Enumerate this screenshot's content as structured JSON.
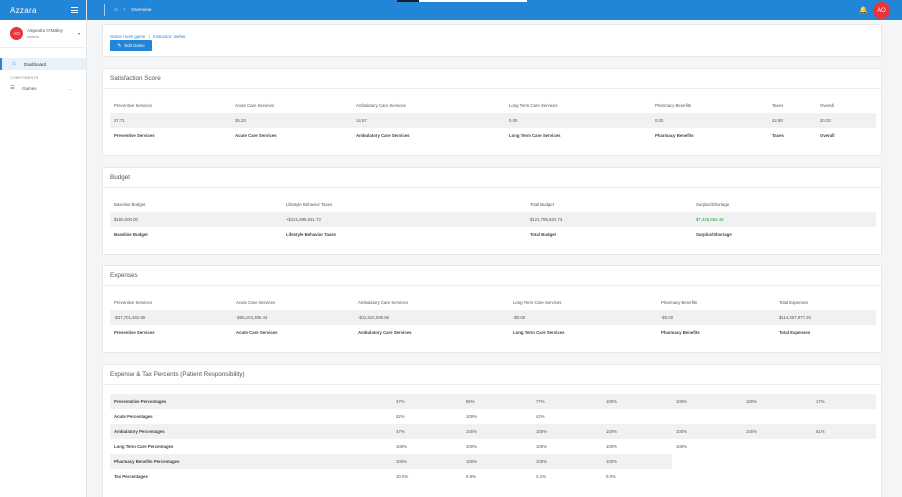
{
  "app": {
    "brand": "Azzara"
  },
  "user": {
    "initials": "AO",
    "name": "Alejandra O'Malley",
    "role": "student"
  },
  "nav": {
    "dashboard": "Dashboard",
    "section_header": "COMPONENTS",
    "games": "Games"
  },
  "topbar": {
    "breadcrumb_current": "Overview",
    "avatar_initials": "AO"
  },
  "overview": {
    "game_link": "Game room game",
    "separator": "|",
    "instructor_link": "Instructor: weber",
    "edit_button": "Edit Game"
  },
  "satisfaction": {
    "title": "Satisfaction Score",
    "headers": [
      "Preventive Services",
      "Acute Care Services",
      "Ambulatory Care Services",
      "Long Term Care Services",
      "Pharmacy Benefits",
      "Taxes",
      "Overall"
    ],
    "values": [
      "27.71",
      "35.33",
      "14.57",
      "0.00",
      "0.00",
      "42.80",
      "20.02"
    ],
    "footers": [
      "Preventive Services",
      "Acute Care Services",
      "Ambulatory Care Services",
      "Long Term Care Services",
      "Pharmacy Benefits",
      "Taxes",
      "Overall"
    ]
  },
  "budget": {
    "title": "Budget",
    "headers": [
      "Baseline Budget",
      "Lifestyle Behavior Taxes",
      "Total Budget",
      "Surplus/Shortage"
    ],
    "values": [
      "$150,000.00",
      "+$121,686,631.73",
      "$121,786,631.73",
      "$7,428,654.46"
    ],
    "footers": [
      "Baseline Budget",
      "Lifestyle Behavior Taxes",
      "Total Budget",
      "Surplus/Shortage"
    ],
    "positive_color": "#2a9d3a"
  },
  "expenses": {
    "title": "Expenses",
    "headers": [
      "Preventive Services",
      "Acute Care Services",
      "Ambulatory Care Services",
      "Long Term Care Services",
      "Pharmacy Benefits",
      "Total Expenses"
    ],
    "values": [
      "-$37,701,462.86",
      "-$65,104,385.44",
      "-$11,522,038.95",
      "-$0.00",
      "-$0.00",
      "$114,357,977.25"
    ],
    "footers": [
      "Preventive Services",
      "Acute Care Services",
      "Ambulatory Care Services",
      "Long Term Care Services",
      "Pharmacy Benefits",
      "Total Expenses"
    ]
  },
  "percents": {
    "title": "Expense & Tax Percents (Patient Responsibility)",
    "rows": [
      {
        "label": "Preventative Percentages",
        "values": [
          "47%",
          "85%",
          "77%",
          "100%",
          "100%",
          "100%",
          "17%"
        ]
      },
      {
        "label": "Acute Percentages",
        "values": [
          "52%",
          "100%",
          "42%",
          "",
          "",
          "",
          ""
        ]
      },
      {
        "label": "Ambulatory Percentages",
        "values": [
          "47%",
          "100%",
          "100%",
          "100%",
          "100%",
          "100%",
          "51%"
        ]
      },
      {
        "label": "Long Term Care Percentages",
        "values": [
          "100%",
          "100%",
          "100%",
          "100%",
          "100%",
          "",
          ""
        ]
      },
      {
        "label": "Pharmacy Benefits Percentages",
        "values": [
          "100%",
          "100%",
          "100%",
          "100%",
          "",
          "",
          ""
        ]
      },
      {
        "label": "Tax Percentages",
        "values": [
          "10.0%",
          "9.8%",
          "3.2%",
          "0.0%",
          "",
          "",
          ""
        ]
      }
    ]
  },
  "colors": {
    "primary": "#2185d8",
    "avatar": "#e8343a"
  }
}
